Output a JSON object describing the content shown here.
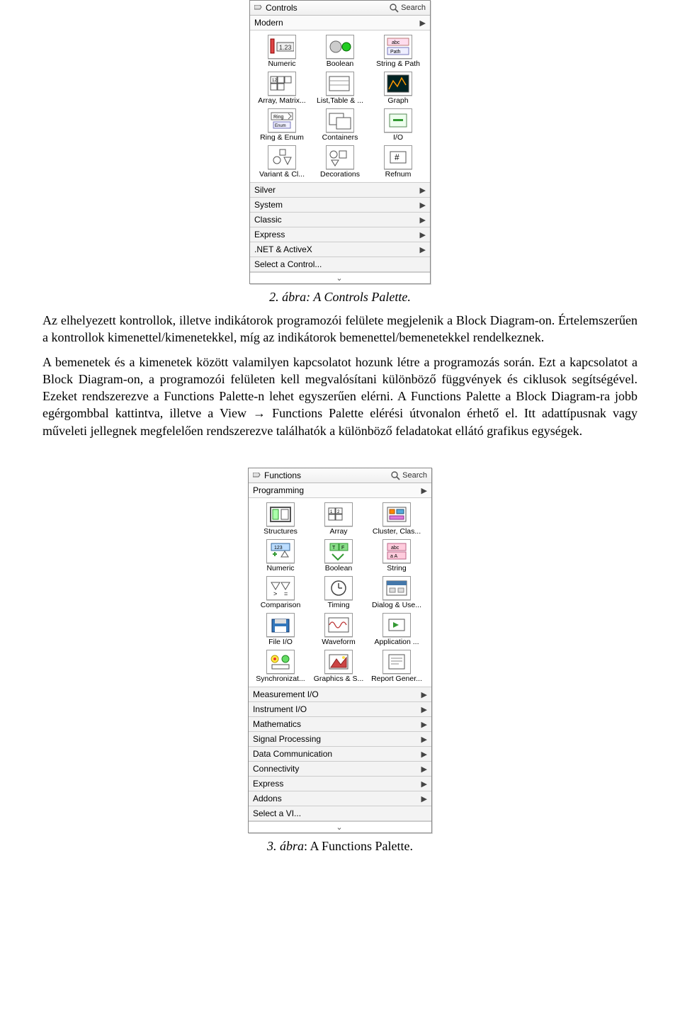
{
  "captions": {
    "fig2": "2. ábra: A Controls Palette.",
    "fig3_prefix": "3. ábra",
    "fig3_rest": ": A Functions Palette."
  },
  "paragraphs": {
    "p1": "Az elhelyezett kontrollok, illetve indikátorok programozói felülete megjelenik a Block Diagram-on. Értelemszerűen a kontrollok kimenettel/kimenetekkel, míg az indikátorok bemenettel/bemenetekkel rendelkeznek.",
    "p2": "A bemenetek és a kimenetek között valamilyen kapcsolatot hozunk létre a programozás során. Ezt a kapcsolatot a Block Diagram-on, a programozói felületen kell megvalósítani különböző függvények és ciklusok segítségével. Ezeket rendszerezve a Functions Palette-n lehet egyszerűen elérni. A Functions Palette a Block Diagram-ra jobb egérgombbal kattintva, illetve a View → Functions Palette elérési útvonalon érhető el. Itt adattípusnak vagy műveleti jellegnek megfelelően rendszerezve találhatók a különböző feladatokat ellátó grafikus egységek."
  },
  "controls_palette": {
    "title": "Controls",
    "search": "Search",
    "open_category": "Modern",
    "items": [
      {
        "label": "Numeric",
        "icon": "numeric"
      },
      {
        "label": "Boolean",
        "icon": "boolean"
      },
      {
        "label": "String & Path",
        "icon": "string"
      },
      {
        "label": "Array, Matrix...",
        "icon": "array"
      },
      {
        "label": "List,Table & ...",
        "icon": "list"
      },
      {
        "label": "Graph",
        "icon": "graph"
      },
      {
        "label": "Ring & Enum",
        "icon": "ring"
      },
      {
        "label": "Containers",
        "icon": "containers"
      },
      {
        "label": "I/O",
        "icon": "io"
      },
      {
        "label": "Variant & Cl...",
        "icon": "variant"
      },
      {
        "label": "Decorations",
        "icon": "decor"
      },
      {
        "label": "Refnum",
        "icon": "refnum"
      }
    ],
    "sub": [
      "Silver",
      "System",
      "Classic",
      "Express",
      ".NET & ActiveX",
      "Select a Control..."
    ]
  },
  "functions_palette": {
    "title": "Functions",
    "search": "Search",
    "open_category": "Programming",
    "items": [
      {
        "label": "Structures",
        "icon": "struct"
      },
      {
        "label": "Array",
        "icon": "farray"
      },
      {
        "label": "Cluster, Clas...",
        "icon": "cluster"
      },
      {
        "label": "Numeric",
        "icon": "fnumeric"
      },
      {
        "label": "Boolean",
        "icon": "fboolean"
      },
      {
        "label": "String",
        "icon": "fstring"
      },
      {
        "label": "Comparison",
        "icon": "comp"
      },
      {
        "label": "Timing",
        "icon": "timing"
      },
      {
        "label": "Dialog & Use...",
        "icon": "dialog"
      },
      {
        "label": "File I/O",
        "icon": "fileio"
      },
      {
        "label": "Waveform",
        "icon": "wave"
      },
      {
        "label": "Application ...",
        "icon": "app"
      },
      {
        "label": "Synchronizat...",
        "icon": "sync"
      },
      {
        "label": "Graphics & S...",
        "icon": "gfx"
      },
      {
        "label": "Report Gener...",
        "icon": "report"
      }
    ],
    "sub": [
      "Measurement I/O",
      "Instrument I/O",
      "Mathematics",
      "Signal Processing",
      "Data Communication",
      "Connectivity",
      "Express",
      "Addons",
      "Select a VI..."
    ]
  }
}
